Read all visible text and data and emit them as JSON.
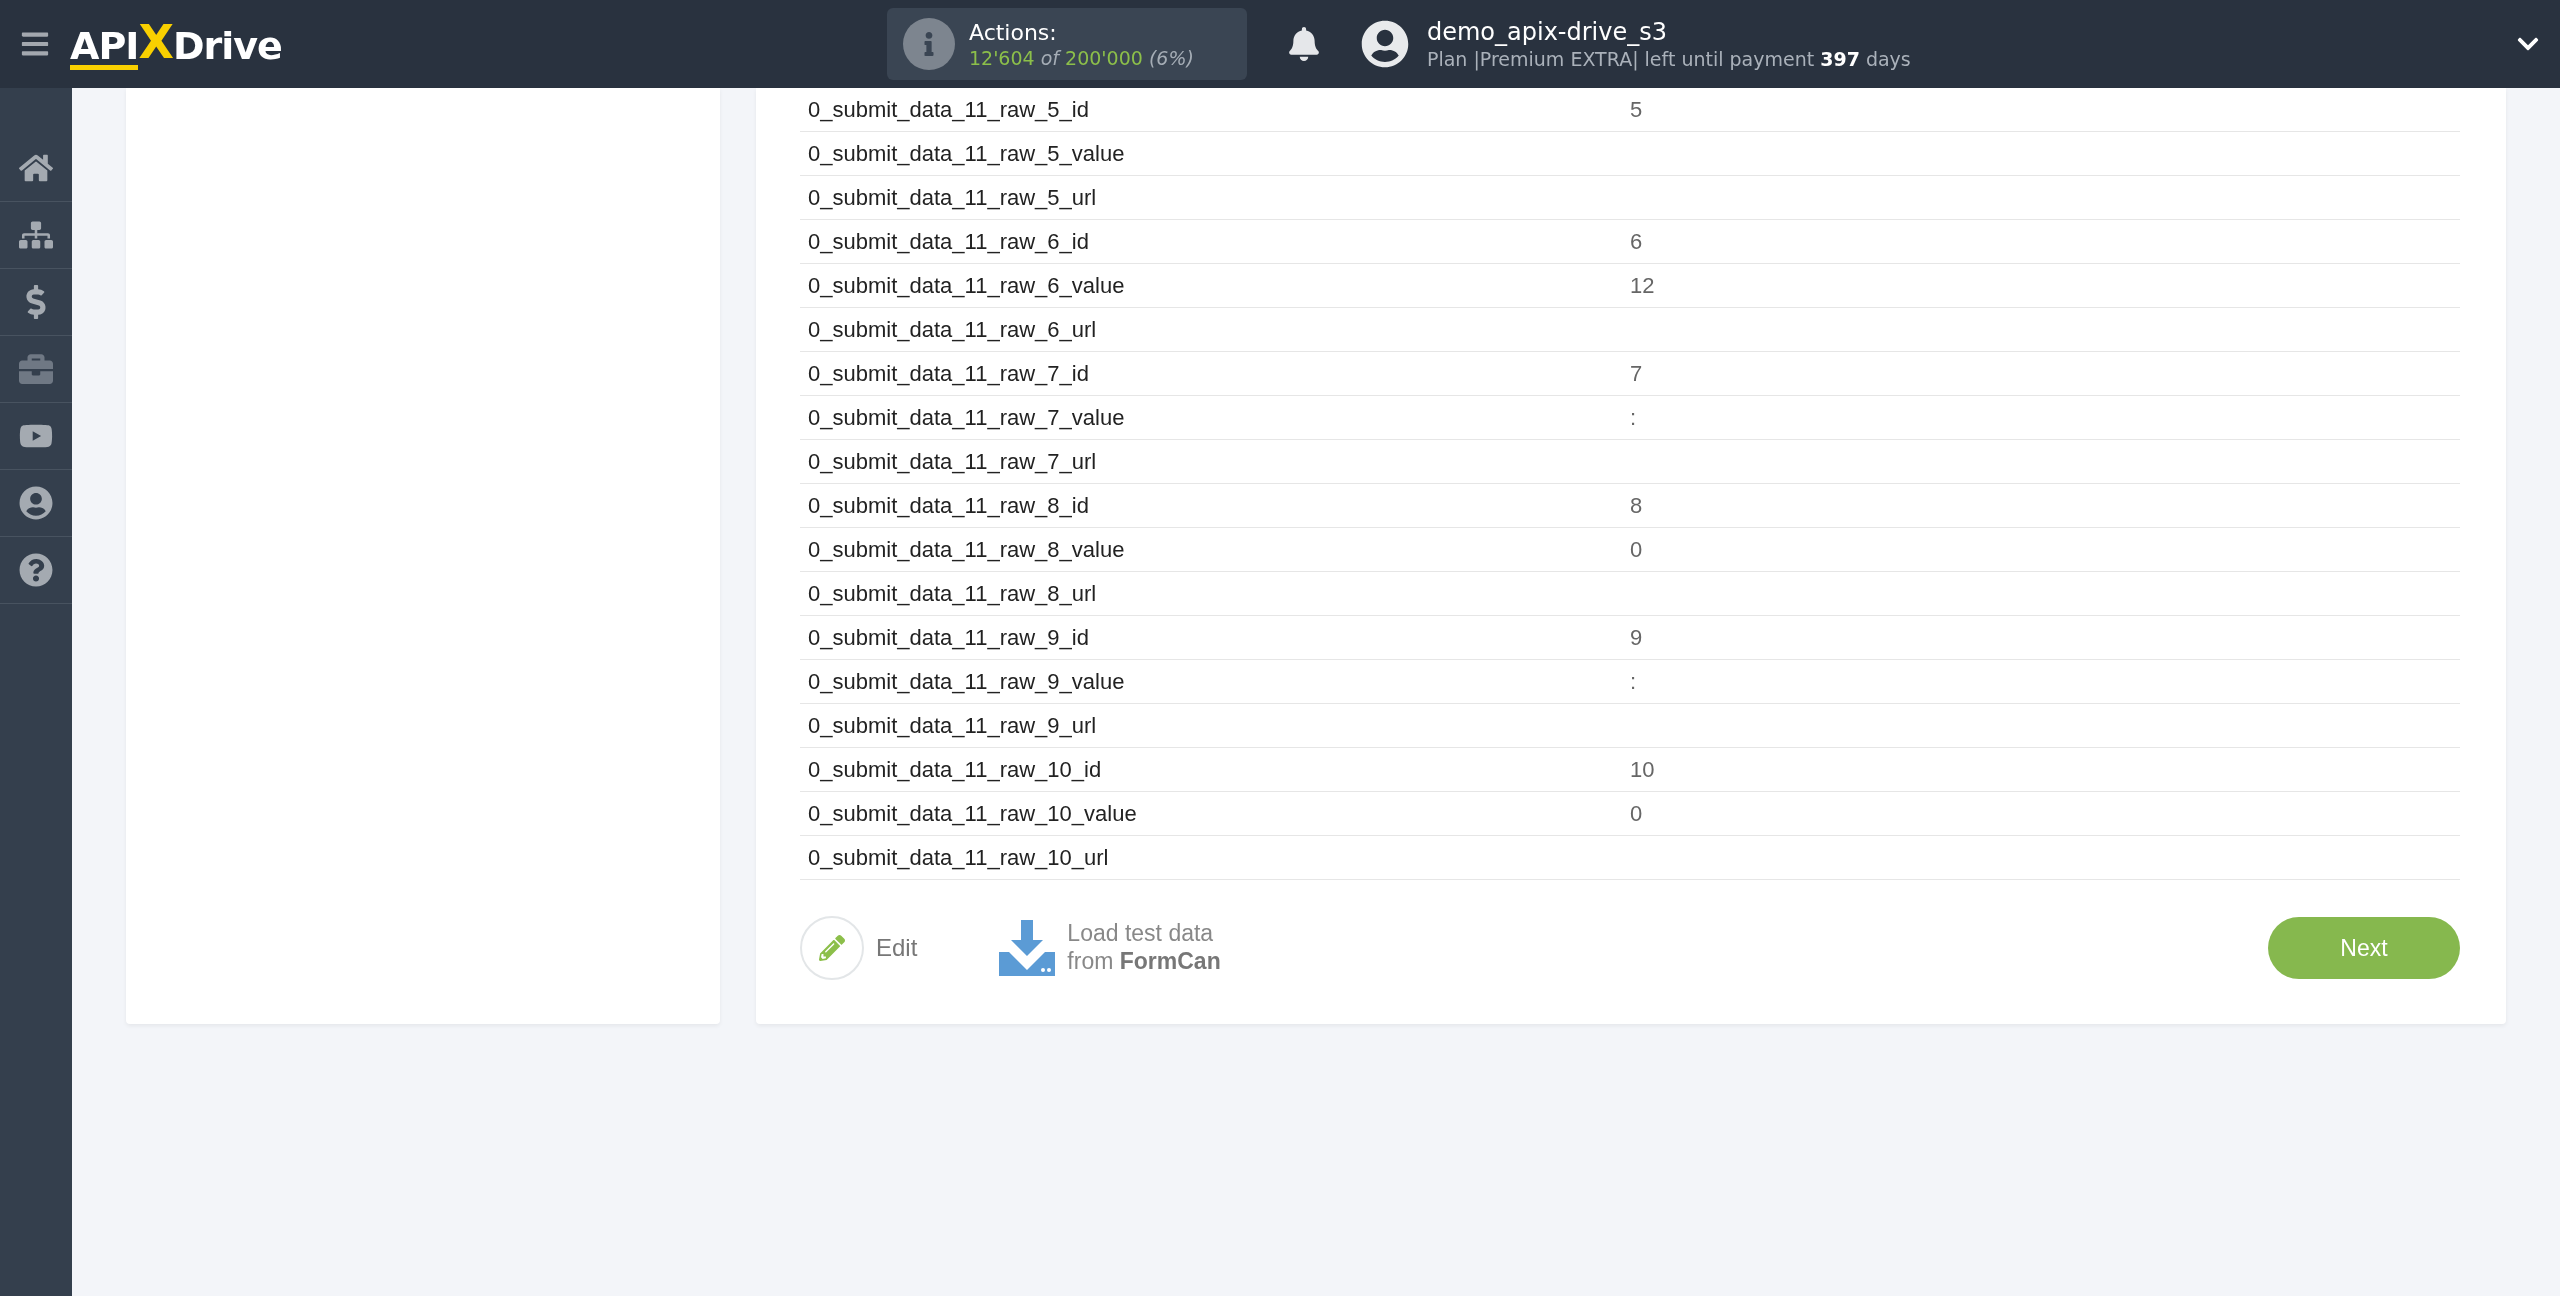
{
  "header": {
    "logo": {
      "left": "API",
      "mark": "X",
      "right": "Drive"
    },
    "actions": {
      "label": "Actions:",
      "used": "12'604",
      "of": "of",
      "total": "200'000",
      "percent": "(6%)"
    },
    "user": {
      "name": "demo_apix-drive_s3",
      "plan": "Plan |Premium EXTRA| left until payment **397** days"
    }
  },
  "rows": [
    {
      "field": "0_submit_data_11_raw_5_id",
      "value": "5"
    },
    {
      "field": "0_submit_data_11_raw_5_value",
      "value": ""
    },
    {
      "field": "0_submit_data_11_raw_5_url",
      "value": ""
    },
    {
      "field": "0_submit_data_11_raw_6_id",
      "value": "6"
    },
    {
      "field": "0_submit_data_11_raw_6_value",
      "value": "12"
    },
    {
      "field": "0_submit_data_11_raw_6_url",
      "value": ""
    },
    {
      "field": "0_submit_data_11_raw_7_id",
      "value": "7"
    },
    {
      "field": "0_submit_data_11_raw_7_value",
      "value": ":"
    },
    {
      "field": "0_submit_data_11_raw_7_url",
      "value": ""
    },
    {
      "field": "0_submit_data_11_raw_8_id",
      "value": "8"
    },
    {
      "field": "0_submit_data_11_raw_8_value",
      "value": "0"
    },
    {
      "field": "0_submit_data_11_raw_8_url",
      "value": ""
    },
    {
      "field": "0_submit_data_11_raw_9_id",
      "value": "9"
    },
    {
      "field": "0_submit_data_11_raw_9_value",
      "value": ":"
    },
    {
      "field": "0_submit_data_11_raw_9_url",
      "value": ""
    },
    {
      "field": "0_submit_data_11_raw_10_id",
      "value": "10"
    },
    {
      "field": "0_submit_data_11_raw_10_value",
      "value": "0"
    },
    {
      "field": "0_submit_data_11_raw_10_url",
      "value": ""
    }
  ],
  "footer": {
    "edit": "Edit",
    "load_line1": "Load test data",
    "load_line2": "from **FormCan**",
    "next": "Next"
  }
}
